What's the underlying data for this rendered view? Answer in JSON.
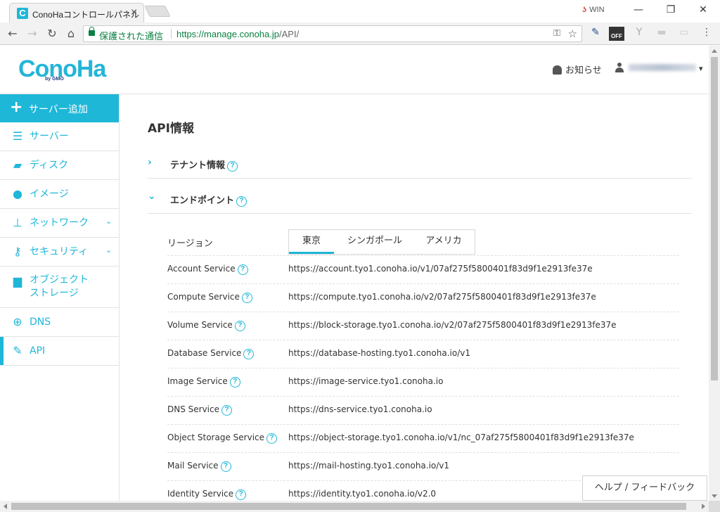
{
  "browser": {
    "tab_title": "ConoHaコントロールパネル",
    "tab_close": "×",
    "favicon_letter": "C",
    "win_badge": "WIN",
    "win_logo": "ʖ",
    "minimize": "—",
    "maximize": "❐",
    "close": "✕",
    "back": "←",
    "forward": "→",
    "reload": "↻",
    "home": "⌂",
    "secure_label": "保護された通信",
    "url_host": "https://manage.conoha.jp",
    "url_path": "/API/",
    "key_glyph": "⚿",
    "star_glyph": "☆",
    "ext_pen": "✎",
    "ext_off": "OFF",
    "ext_tool": "Y",
    "ext_box1": "▬",
    "ext_box2": "▭",
    "menu_glyph": "⋮"
  },
  "header": {
    "logo": "ConoHa",
    "logo_sub": "by GMO",
    "notify_label": "お知らせ",
    "user_chevron": "▾"
  },
  "sidebar": {
    "add_server": {
      "icon": "+",
      "label": "サーバー追加"
    },
    "items": [
      {
        "label": "サーバー",
        "icon": "☰",
        "chevron": ""
      },
      {
        "label": "ディスク",
        "icon": "▰",
        "chevron": ""
      },
      {
        "label": "イメージ",
        "icon": "●",
        "chevron": ""
      },
      {
        "label": "ネットワーク",
        "icon": "⊥",
        "chevron": "⌄"
      },
      {
        "label": "セキュリティ",
        "icon": "⚷",
        "chevron": "⌄"
      },
      {
        "label": "オブジェクト",
        "label2": "ストレージ",
        "icon": "▆",
        "chevron": ""
      },
      {
        "label": "DNS",
        "icon": "⊕",
        "chevron": ""
      },
      {
        "label": "API",
        "icon": "✎",
        "chevron": ""
      }
    ]
  },
  "main": {
    "page_title": "API情報",
    "accordions": [
      {
        "title": "テナント情報",
        "arrow": "›",
        "help": "?"
      },
      {
        "title": "エンドポイント",
        "arrow": "⌄",
        "help": "?"
      }
    ],
    "region_label": "リージョン",
    "region_tabs": [
      "東京",
      "シンガポール",
      "アメリカ"
    ],
    "help_glyph": "?",
    "endpoints": [
      {
        "name": "Account Service",
        "url": "https://account.tyo1.conoha.io/v1/07af275f5800401f83d9f1e2913fe37e"
      },
      {
        "name": "Compute Service",
        "url": "https://compute.tyo1.conoha.io/v2/07af275f5800401f83d9f1e2913fe37e"
      },
      {
        "name": "Volume Service",
        "url": "https://block-storage.tyo1.conoha.io/v2/07af275f5800401f83d9f1e2913fe37e"
      },
      {
        "name": "Database Service",
        "url": "https://database-hosting.tyo1.conoha.io/v1"
      },
      {
        "name": "Image Service",
        "url": "https://image-service.tyo1.conoha.io"
      },
      {
        "name": "DNS Service",
        "url": "https://dns-service.tyo1.conoha.io"
      },
      {
        "name": "Object Storage Service",
        "url": "https://object-storage.tyo1.conoha.io/v1/nc_07af275f5800401f83d9f1e2913fe37e"
      },
      {
        "name": "Mail Service",
        "url": "https://mail-hosting.tyo1.conoha.io/v1"
      },
      {
        "name": "Identity Service",
        "url": "https://identity.tyo1.conoha.io/v2.0"
      }
    ],
    "feedback_label": "ヘルプ / フィードバック"
  },
  "colors": {
    "accent": "#1fb7d8",
    "secure": "#0b8043"
  }
}
